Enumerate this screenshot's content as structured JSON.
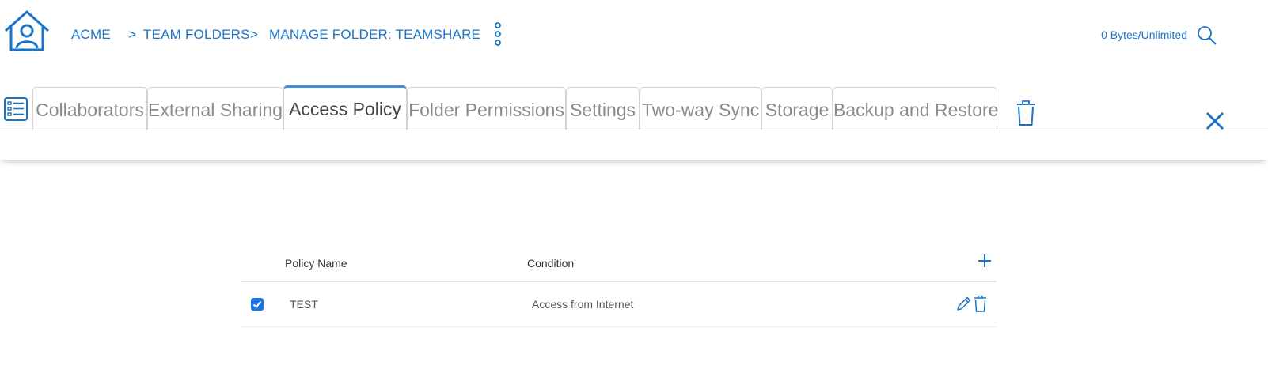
{
  "breadcrumb": {
    "root": "ACME",
    "sep1": ">",
    "item1": "TEAM FOLDERS",
    "sep2": ">",
    "item2": "MANAGE FOLDER: TEAMSHARE"
  },
  "storage": {
    "text": "0 Bytes/Unlimited"
  },
  "tabs": [
    {
      "label": "Collaborators",
      "active": false
    },
    {
      "label": "External Sharing",
      "active": false
    },
    {
      "label": "Access Policy",
      "active": true
    },
    {
      "label": "Folder Permissions",
      "active": false
    },
    {
      "label": "Settings",
      "active": false
    },
    {
      "label": "Two-way Sync",
      "active": false
    },
    {
      "label": "Storage",
      "active": false
    },
    {
      "label": "Backup and Restore",
      "active": false
    }
  ],
  "table": {
    "columns": {
      "policy_name": "Policy Name",
      "condition": "Condition"
    },
    "rows": [
      {
        "checked": true,
        "name": "TEST",
        "condition": "Access from Internet"
      }
    ]
  },
  "icons": {
    "home": "home-user-icon",
    "kebab": "more-vertical-icon",
    "search": "search-icon",
    "list": "list-icon",
    "trash": "trash-icon",
    "close": "close-icon",
    "add": "plus-icon",
    "edit": "pencil-icon"
  },
  "colors": {
    "accent": "#1a73c8",
    "active_tab_border": "#3d8ee0",
    "checkbox": "#1a73e8"
  }
}
